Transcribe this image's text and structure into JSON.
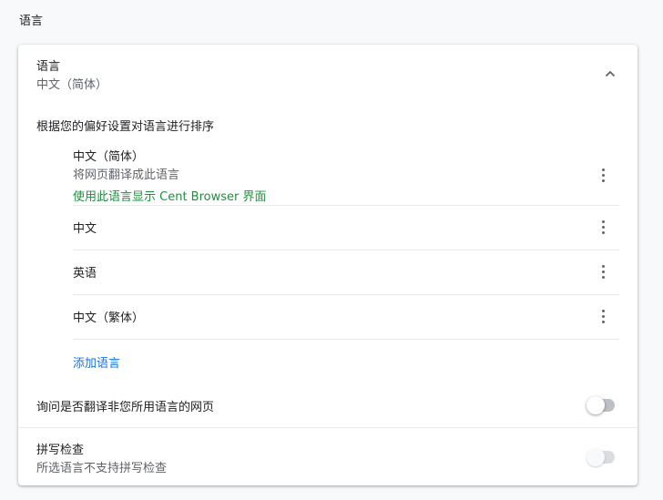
{
  "section": {
    "title": "语言"
  },
  "languages_header": {
    "title": "语言",
    "current": "中文（简体）"
  },
  "order_label": "根据您的偏好设置对语言进行排序",
  "languages": [
    {
      "name": "中文（简体）",
      "translate_note": "将网页翻译成此语言",
      "display_note": "使用此语言显示 Cent Browser 界面"
    },
    {
      "name": "中文"
    },
    {
      "name": "英语"
    },
    {
      "name": "中文（繁体）"
    }
  ],
  "add_language": "添加语言",
  "offer_translate": {
    "label": "询问是否翻译非您所用语言的网页",
    "enabled": false
  },
  "spellcheck": {
    "title": "拼写检查",
    "subtitle": "所选语言不支持拼写检查",
    "enabled": false,
    "disabled": true
  },
  "colors": {
    "accent": "#1a73e8",
    "green_note": "#1e8e3e",
    "secondary_text": "#5f6368",
    "background": "#f8f9fa"
  },
  "icons": {
    "collapse": "chevron-up-icon",
    "more": "more-vert-icon"
  }
}
